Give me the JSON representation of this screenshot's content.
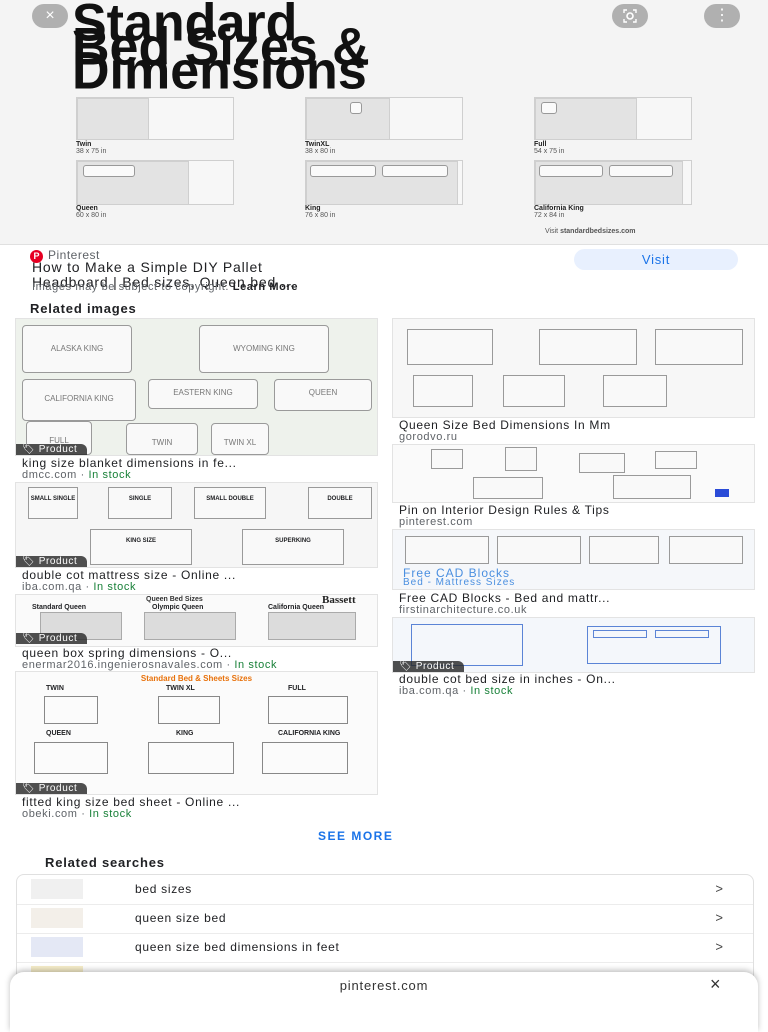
{
  "hero": {
    "title_lines": [
      "Standard",
      "Bed Sizes &",
      "Dimensions"
    ],
    "close_icon": "×",
    "lens_icon": "lens-icon",
    "more_icon": "⋮",
    "beds": [
      {
        "name": "Twin",
        "dim": "38 x 75 in"
      },
      {
        "name": "TwinXL",
        "dim": "38 x 80 in"
      },
      {
        "name": "Full",
        "dim": "54 x 75 in"
      },
      {
        "name": "Queen",
        "dim": "60 x 80 in"
      },
      {
        "name": "King",
        "dim": "76 x 80 in"
      },
      {
        "name": "California King",
        "dim": "72 x 84 in"
      }
    ],
    "visit_prefix": "Visit",
    "visit_site": "standardbedsizes.com"
  },
  "source": {
    "icon": "P",
    "name": "Pinterest",
    "title_line1": "How to Make a Simple DIY Pallet",
    "title_line2": "Headboard | Bed sizes, Queen bed ...",
    "note": "Images may be subject to copyright.",
    "learn_more": "Learn More",
    "visit_label": "Visit"
  },
  "related_images_heading": "Related images",
  "product_badge": "Product",
  "left_results": [
    {
      "title": "king size blanket dimensions in fe...",
      "source": "dmcc.com",
      "stock": "In stock"
    },
    {
      "title": "double cot mattress size - Online ...",
      "source": "iba.com.qa",
      "stock": "In stock"
    },
    {
      "title": "queen box spring dimensions - O...",
      "source": "enermar2016.ingenierosnavales.com",
      "stock": "In stock"
    },
    {
      "title": "fitted king size bed sheet - Online ...",
      "source": "obeki.com",
      "stock": "In stock"
    }
  ],
  "right_results": [
    {
      "title": "Queen Size Bed Dimensions In Mm",
      "source": "gorodvo.ru",
      "stock": ""
    },
    {
      "title": "Pin on Interior Design Rules & Tips",
      "source": "pinterest.com",
      "stock": ""
    },
    {
      "title": "Free CAD Blocks - Bed and mattr...",
      "source": "firstinarchitecture.co.uk",
      "stock": ""
    },
    {
      "title": "double cot bed size in inches - On...",
      "source": "iba.com.qa",
      "stock": "In stock"
    }
  ],
  "thumb_text": {
    "t1": [
      "ALASKA KING",
      "WYOMING KING",
      "CALIFORNIA KING",
      "EASTERN KING",
      "QUEEN",
      "FULL",
      "TWIN",
      "TWIN XL"
    ],
    "t2": [
      "SMALL SINGLE",
      "SINGLE",
      "SMALL DOUBLE",
      "DOUBLE",
      "KING SIZE",
      "SUPERKING"
    ],
    "t3_title": "Queen Bed Sizes",
    "t3_brand": "Bassett",
    "t3": [
      "Standard Queen",
      "Olympic Queen",
      "California Queen"
    ],
    "t4_title": "Standard Bed & Sheets Sizes",
    "t4": [
      "TWIN",
      "TWIN XL",
      "FULL",
      "QUEEN",
      "KING",
      "CALIFORNIA KING"
    ],
    "r3_overlay1": "Free CAD Blocks",
    "r3_overlay2": "Bed - Mattress Sizes"
  },
  "see_more": "SEE MORE",
  "related_searches_heading": "Related searches",
  "related_searches": [
    {
      "text": "bed sizes"
    },
    {
      "text": "queen size bed"
    },
    {
      "text": "queen size bed dimensions in feet"
    }
  ],
  "chevron": ">",
  "sheet": {
    "url": "pinterest.com",
    "close": "×"
  }
}
